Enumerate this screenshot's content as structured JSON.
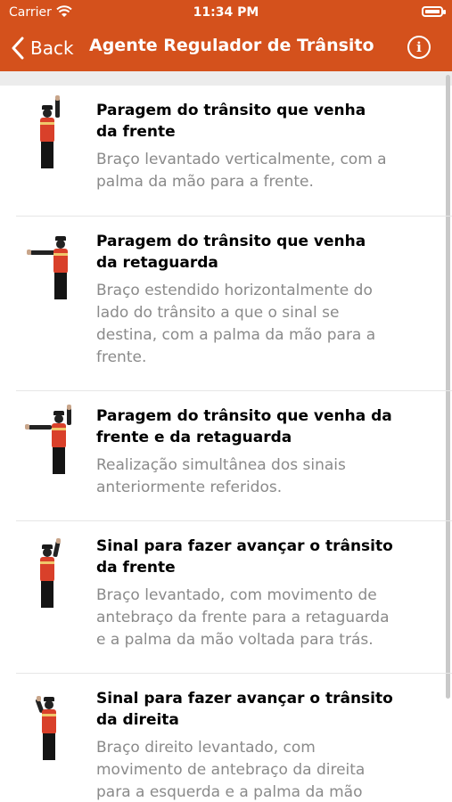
{
  "status": {
    "carrier": "Carrier",
    "time": "11:34 PM"
  },
  "nav": {
    "back_label": "Back",
    "title": "Agente Regulador de Trânsito",
    "info_glyph": "i"
  },
  "icons": {
    "back": "chevron-left-icon",
    "info": "info-icon",
    "wifi": "wifi-icon",
    "battery": "battery-icon"
  },
  "colors": {
    "header": "#d4511c",
    "title_text": "#000000",
    "desc_text": "#8a8a8a"
  },
  "signals": [
    {
      "title_l1": "Paragem do trânsito que venha",
      "title_l2": "da frente",
      "desc_lines": [
        "Braço levantado verticalmente, com a",
        "palma da mão para a frente."
      ]
    },
    {
      "title_l1": "Paragem do trânsito que venha",
      "title_l2": "da retaguarda",
      "desc_lines": [
        "Braço estendido horizontalmente do",
        "lado do trânsito a que o sinal se",
        "destina, com a palma da mão para a",
        "frente."
      ]
    },
    {
      "title_l1": "Paragem do trânsito que venha da",
      "title_l2": "frente e da retaguarda",
      "desc_lines": [
        "Realização simultânea dos sinais",
        "anteriormente referidos."
      ]
    },
    {
      "title_l1": "Sinal para fazer avançar o trânsito",
      "title_l2": "da frente",
      "desc_lines": [
        "Braço levantado, com movimento de",
        "antebraço da frente para a retaguarda",
        "e a palma da mão voltada para trás."
      ]
    },
    {
      "title_l1": "Sinal para fazer avançar o trânsito",
      "title_l2": "da direita",
      "desc_lines": [
        "Braço direito levantado, com",
        "movimento de antebraço da direita",
        "para a esquerda e a palma da mão"
      ]
    }
  ]
}
